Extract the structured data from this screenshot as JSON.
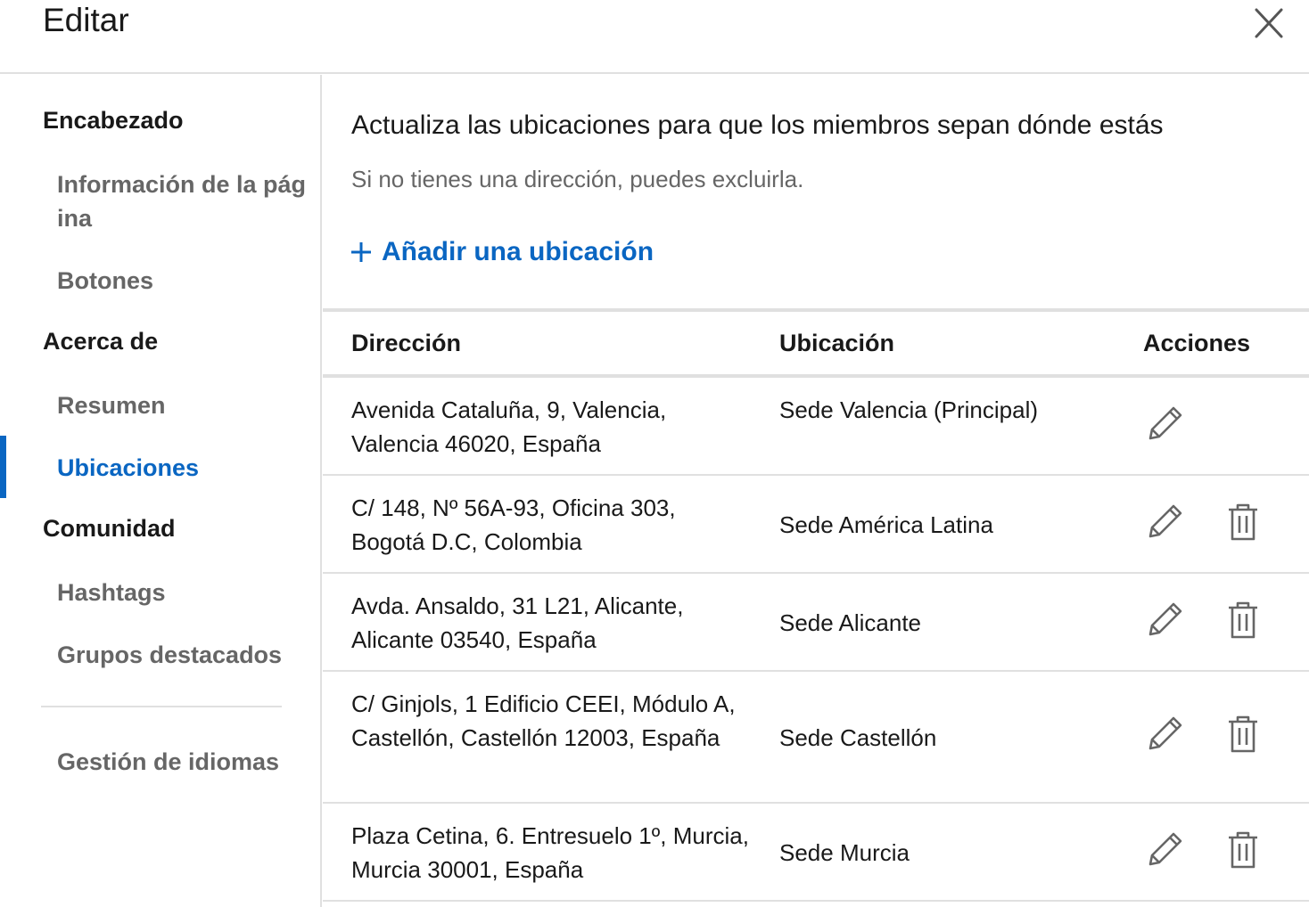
{
  "header": {
    "title": "Editar"
  },
  "sidebar": {
    "sections": [
      {
        "label": "Encabezado"
      },
      {
        "label": "Acerca de"
      },
      {
        "label": "Comunidad"
      }
    ],
    "items": [
      {
        "label": "Información de la página"
      },
      {
        "label": "Botones"
      },
      {
        "label": "Resumen"
      },
      {
        "label": "Ubicaciones",
        "active": true
      },
      {
        "label": "Hashtags"
      },
      {
        "label": "Grupos destacados"
      },
      {
        "label": "Gestión de idiomas"
      }
    ]
  },
  "main": {
    "title": "Actualiza las ubicaciones para que los miembros sepan dónde estás",
    "subtitle": "Si no tienes una dirección, puedes excluirla.",
    "add_label": "Añadir una ubicación"
  },
  "table": {
    "headers": {
      "address": "Dirección",
      "location": "Ubicación",
      "actions": "Acciones"
    },
    "rows": [
      {
        "address": "Avenida Cataluña, 9, Valencia, Valencia 46020, España",
        "location": "Sede Valencia (Principal)",
        "deletable": false
      },
      {
        "address": "C/ 148, Nº 56A-93, Oficina 303, Bogotá D.C, Colombia",
        "location": "Sede América Latina",
        "deletable": true
      },
      {
        "address": "Avda. Ansaldo, 31 L21, Alicante, Alicante 03540, España",
        "location": "Sede Alicante",
        "deletable": true
      },
      {
        "address": "C/ Ginjols, 1 Edificio CEEI, Módulo A, Castellón, Castellón 12003, España",
        "location": "Sede Castellón",
        "deletable": true
      },
      {
        "address": "Plaza Cetina, 6. Entresuelo 1º, Murcia, Murcia 30001, España",
        "location": "Sede Murcia",
        "deletable": true
      }
    ]
  },
  "icons": {
    "close": "close-icon",
    "add": "plus-icon",
    "edit": "pencil-icon",
    "delete": "trash-icon"
  },
  "colors": {
    "accent": "#0a66c2",
    "muted_text": "#666666",
    "divider": "#e0e0e0"
  }
}
